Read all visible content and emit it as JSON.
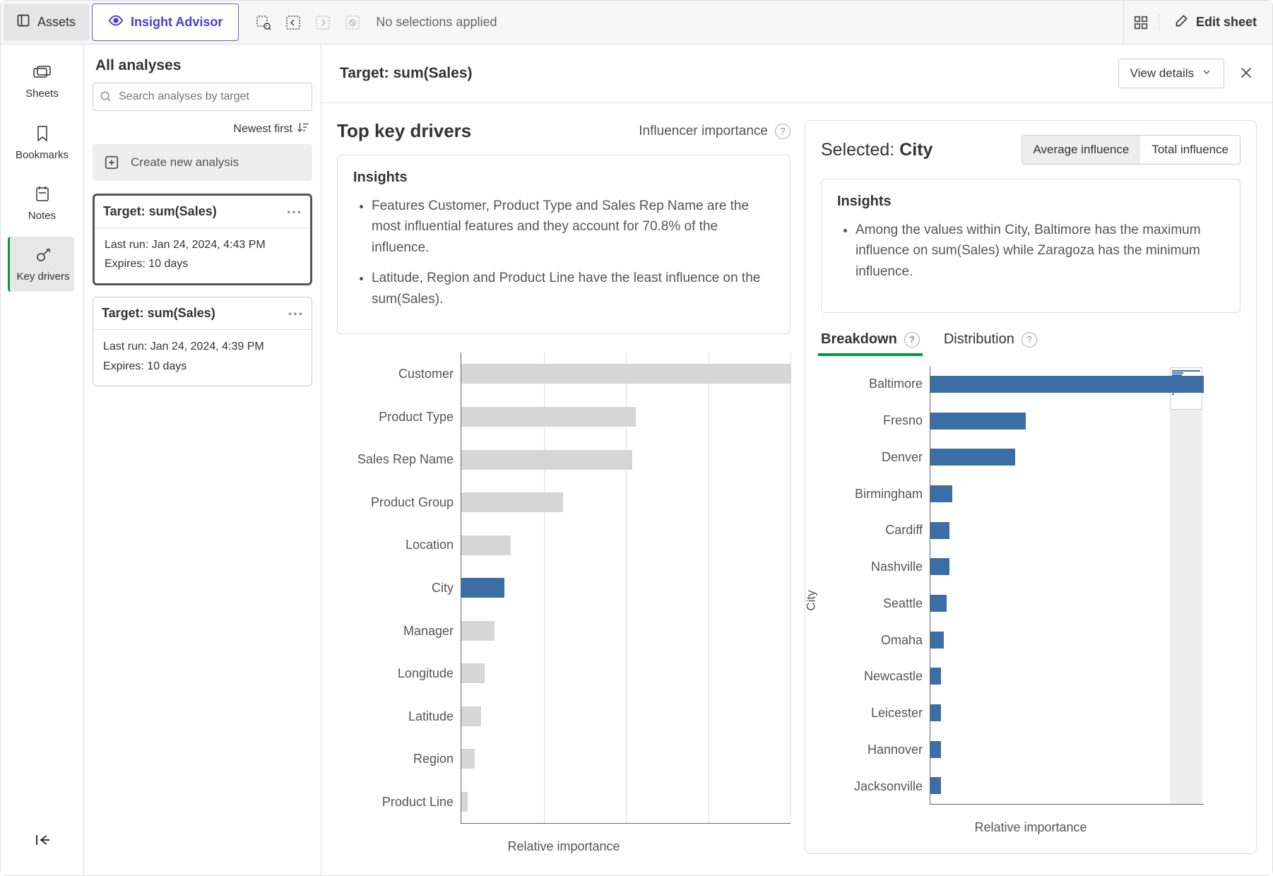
{
  "topbar": {
    "assets": "Assets",
    "insightAdvisor": "Insight Advisor",
    "noSelections": "No selections applied",
    "editSheet": "Edit sheet"
  },
  "farSidebar": {
    "items": [
      {
        "label": "Sheets",
        "icon": "sheets"
      },
      {
        "label": "Bookmarks",
        "icon": "bookmark"
      },
      {
        "label": "Notes",
        "icon": "notes"
      },
      {
        "label": "Key drivers",
        "icon": "keydrivers",
        "active": true
      }
    ]
  },
  "analysesPanel": {
    "title": "All analyses",
    "searchPlaceholder": "Search analyses by target",
    "sortLabel": "Newest first",
    "createLabel": "Create new analysis",
    "cards": [
      {
        "title": "Target: sum(Sales)",
        "lastRun": "Last run: Jan 24, 2024, 4:43 PM",
        "expires": "Expires: 10 days",
        "active": true
      },
      {
        "title": "Target: sum(Sales)",
        "lastRun": "Last run: Jan 24, 2024, 4:39 PM",
        "expires": "Expires: 10 days",
        "active": false
      }
    ]
  },
  "contentHeader": {
    "title": "Target: sum(Sales)",
    "viewDetails": "View details"
  },
  "leftSection": {
    "title": "Top key drivers",
    "influencerLabel": "Influencer importance",
    "insightsHeading": "Insights",
    "insightsBullets": [
      "Features Customer, Product Type and Sales Rep Name are the most influential features and they account for 70.8% of the influence.",
      "Latitude, Region and Product Line have the least influence on the sum(Sales)."
    ],
    "xlabel": "Relative importance"
  },
  "rightSection": {
    "selectedPrefix": "Selected:",
    "selectedValue": "City",
    "avgInfluence": "Average influence",
    "totalInfluence": "Total influence",
    "insightsHeading": "Insights",
    "insightsBullets": [
      "Among the values within City, Baltimore has the maximum influence on sum(Sales) while Zaragoza has the minimum influence."
    ],
    "tabs": {
      "breakdown": "Breakdown",
      "distribution": "Distribution"
    },
    "ylabel": "City",
    "xlabel": "Relative importance"
  },
  "chart_data": [
    {
      "type": "bar",
      "orientation": "horizontal",
      "title": "Top key drivers",
      "xlabel": "Relative importance",
      "ylabel": "",
      "categories": [
        "Customer",
        "Product Type",
        "Sales Rep Name",
        "Product Group",
        "Location",
        "City",
        "Manager",
        "Longitude",
        "Latitude",
        "Region",
        "Product Line"
      ],
      "values": [
        100,
        53,
        52,
        31,
        15,
        13,
        10,
        7,
        6,
        4,
        2
      ],
      "highlight": "City",
      "xlim": [
        0,
        100
      ]
    },
    {
      "type": "bar",
      "orientation": "horizontal",
      "title": "City breakdown",
      "xlabel": "Relative importance",
      "ylabel": "City",
      "categories": [
        "Baltimore",
        "Fresno",
        "Denver",
        "Birmingham",
        "Cardiff",
        "Nashville",
        "Seattle",
        "Omaha",
        "Newcastle",
        "Leicester",
        "Hannover",
        "Jacksonville"
      ],
      "values": [
        100,
        35,
        31,
        8,
        7,
        7,
        6,
        5,
        4,
        4,
        4,
        4
      ],
      "xlim": [
        0,
        100
      ]
    }
  ]
}
